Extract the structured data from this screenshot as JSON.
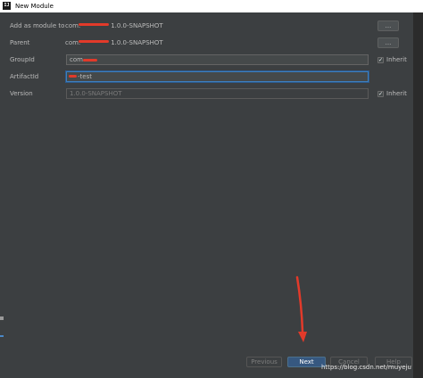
{
  "window": {
    "app_icon": "intellij-icon",
    "app_icon_text": "IJ",
    "title": "New Module"
  },
  "form": {
    "add_as_module_to": {
      "label": "Add as module to",
      "value_prefix": "com.",
      "value_suffix": "1.0.0-SNAPSHOT",
      "browse_label": "..."
    },
    "parent": {
      "label": "Parent",
      "value_prefix": "com.",
      "value_suffix": "1.0.0-SNAPSHOT",
      "browse_label": "..."
    },
    "group_id": {
      "label": "GroupId",
      "value": "com.",
      "inherit_label": "Inherit",
      "inherit_checked": true
    },
    "artifact_id": {
      "label": "ArtifactId",
      "value": "-test"
    },
    "version": {
      "label": "Version",
      "value": "1.0.0-SNAPSHOT",
      "inherit_label": "Inherit",
      "inherit_checked": true
    }
  },
  "buttons": {
    "previous": "Previous",
    "next": "Next",
    "cancel": "Cancel",
    "help": "Help"
  },
  "watermark": "https://blog.csdn.net/muyeju",
  "colors": {
    "background": "#3c3f41",
    "text": "#bbbbbb",
    "redaction": "#e23a2a",
    "focus_border": "#3d7fbf",
    "primary_button": "#365880"
  }
}
